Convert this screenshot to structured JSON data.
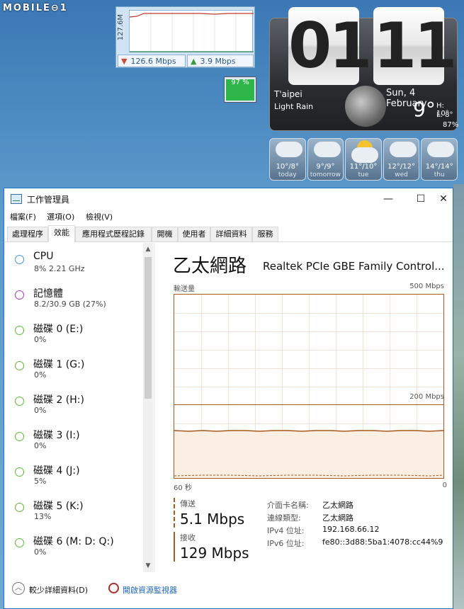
{
  "desktop": {
    "watermark": "MOBILE⊖1",
    "net_meter": {
      "axis_label": "127.6M",
      "download": "126.6 Mbps",
      "upload": "3.9 Mbps"
    },
    "battery": {
      "percent_label": "97 %",
      "level": 0.97
    },
    "clock": {
      "hour": "01",
      "minute": "11",
      "city": "T'aipei",
      "condition": "Light Rain",
      "date": "Sun, 4 February",
      "temp": "9°",
      "high": "H: 10°",
      "low": "L:  8°",
      "humidity": "87%"
    },
    "forecast": [
      {
        "temp": "10°/8°",
        "day": "today",
        "icon": "cloud-icon"
      },
      {
        "temp": "9°/9°",
        "day": "tomorrow",
        "icon": "cloud-icon"
      },
      {
        "temp": "11°/10°",
        "day": "tue",
        "icon": "sun-cloud-icon"
      },
      {
        "temp": "12°/12°",
        "day": "wed",
        "icon": "cloud-icon"
      },
      {
        "temp": "14°/14°",
        "day": "thu",
        "icon": "cloud-icon"
      }
    ]
  },
  "window": {
    "title": "工作管理員",
    "controls": {
      "minimize": "—",
      "maximize": "☐",
      "close": "✕"
    },
    "menu": [
      "檔案(F)",
      "選項(O)",
      "檢視(V)"
    ],
    "tabs": [
      "處理程序",
      "效能",
      "應用程式歷程記錄",
      "開機",
      "使用者",
      "詳細資料",
      "服務"
    ],
    "active_tab": "效能",
    "resources": [
      {
        "name": "CPU",
        "sub": "8%  2.21 GHz",
        "color": "#3a96d9"
      },
      {
        "name": "記憶體",
        "sub": "8.2/30.9 GB (27%)",
        "color": "#a43cb8"
      },
      {
        "name": "磁碟 0 (E:)",
        "sub": "0%",
        "color": "#5dbb35"
      },
      {
        "name": "磁碟 1 (G:)",
        "sub": "0%",
        "color": "#5dbb35"
      },
      {
        "name": "磁碟 2 (H:)",
        "sub": "0%",
        "color": "#5dbb35"
      },
      {
        "name": "磁碟 3 (I:)",
        "sub": "0%",
        "color": "#5dbb35"
      },
      {
        "name": "磁碟 4 (J:)",
        "sub": "5%",
        "color": "#5dbb35"
      },
      {
        "name": "磁碟 5 (K:)",
        "sub": "13%",
        "color": "#5dbb35"
      },
      {
        "name": "磁碟 6 (M: D: Q:)",
        "sub": "0%",
        "color": "#5dbb35"
      }
    ],
    "detail": {
      "title": "乙太網路",
      "device": "Realtek PCIe GBE Family Control...",
      "graph_label": "輸送量",
      "max_label": "500 Mbps",
      "mid_label": "200 Mbps",
      "x_left": "60 秒",
      "x_right": "0",
      "send_label": "傳送",
      "send_value": "5.1 Mbps",
      "recv_label": "接收",
      "recv_value": "129 Mbps",
      "info": [
        {
          "key": "介面卡名稱:",
          "value": "乙太網路"
        },
        {
          "key": "連線類型:",
          "value": "乙太網路"
        },
        {
          "key": "IPv4 位址:",
          "value": "192.168.66.12"
        },
        {
          "key": "IPv6 位址:",
          "value": "fe80::3d88:5ba1:4078:cc44%9"
        }
      ]
    },
    "footer": {
      "fewer_details": "較少詳細資料(D)",
      "open_monitor": "開啟資源監視器"
    },
    "accent_color": "#a65a1b"
  }
}
